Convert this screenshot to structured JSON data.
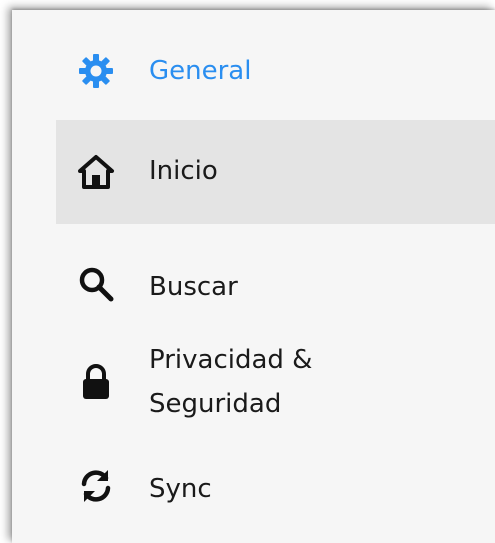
{
  "sidebar": {
    "items": [
      {
        "label": "General",
        "icon": "gear-icon",
        "active": true,
        "color": "#2a8ef0"
      },
      {
        "label": "Inicio",
        "icon": "home-icon",
        "selected": true
      },
      {
        "label": "Buscar",
        "icon": "search-icon"
      },
      {
        "label": "Privacidad & Seguridad",
        "icon": "lock-icon"
      },
      {
        "label": "Sync",
        "icon": "sync-icon"
      }
    ]
  }
}
